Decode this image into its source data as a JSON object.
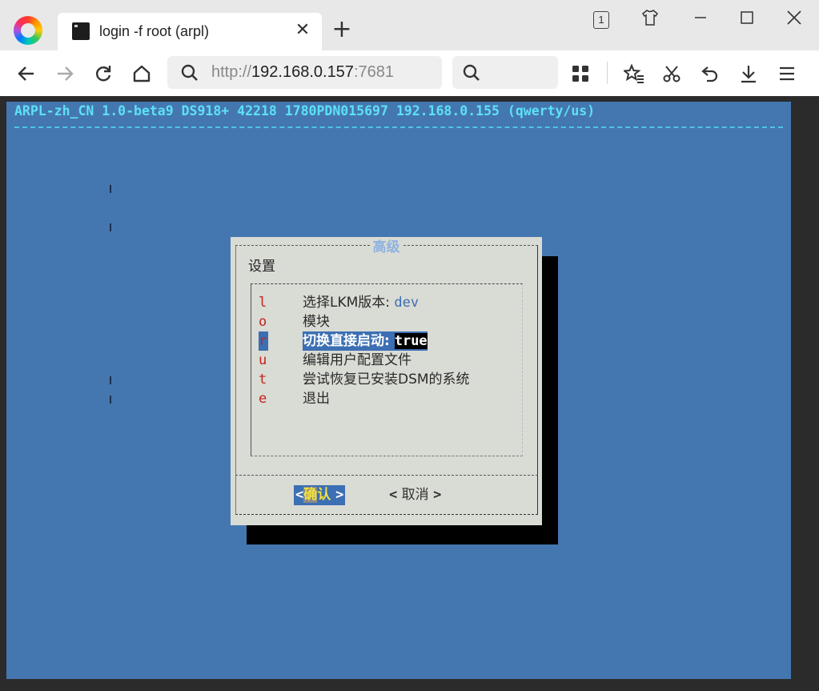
{
  "browser": {
    "tab_title": "login -f root (arpl)",
    "tab_count": "1",
    "url_prefix": "http://",
    "url_host": "192.168.0.157",
    "url_port": ":7681",
    "search_placeholder": ""
  },
  "terminal": {
    "backtitle": "ARPL-zh_CN 1.0-beta9 DS918+ 42218 1780PDN015697 192.168.0.155 (qwerty/us)",
    "bg_color": "#4477b0",
    "dialog": {
      "title": "高级",
      "label": "设置",
      "menu": [
        {
          "key": "l",
          "label": "选择LKM版本: ",
          "value": "dev",
          "selected": false
        },
        {
          "key": "o",
          "label": "模块",
          "value": "",
          "selected": false
        },
        {
          "key": "r",
          "label": "切换直接启动: ",
          "value": "true",
          "selected": true
        },
        {
          "key": "u",
          "label": "编辑用户配置文件",
          "value": "",
          "selected": false
        },
        {
          "key": "t",
          "label": "尝试恢复已安装DSM的系统",
          "value": "",
          "selected": false
        },
        {
          "key": "e",
          "label": "退出",
          "value": "",
          "selected": false
        }
      ],
      "ok_button": {
        "open": "<",
        "first": "确",
        "second": "认",
        "close": ">"
      },
      "cancel_button": {
        "open": "<",
        "label": "取消",
        "close": ">"
      }
    }
  }
}
